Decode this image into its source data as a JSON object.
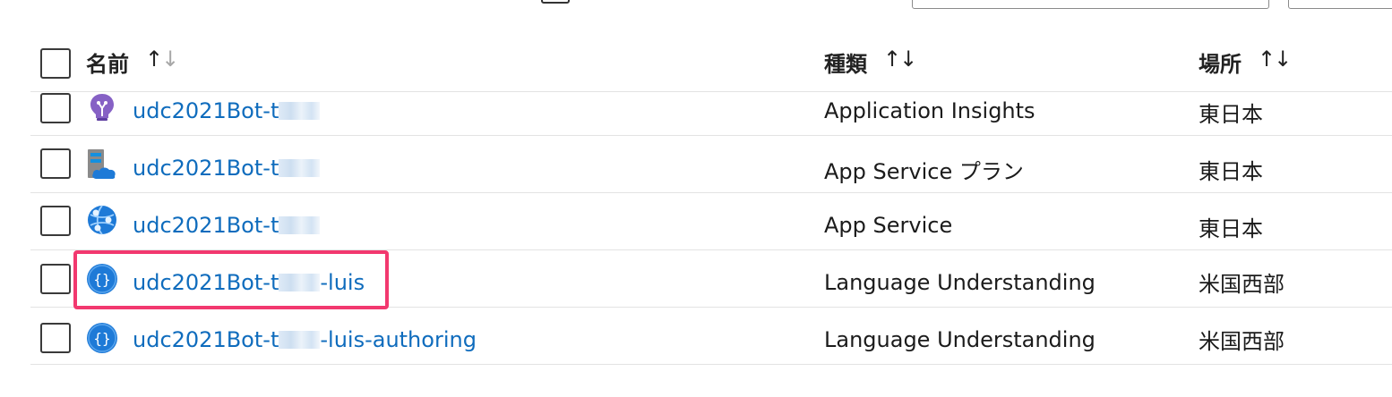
{
  "table": {
    "columns": {
      "name": {
        "label": "名前",
        "sort_up": "↑",
        "sort_down": "↓"
      },
      "type": {
        "label": "種類",
        "sort_up": "↑",
        "sort_down": "↓"
      },
      "location": {
        "label": "場所",
        "sort_up": "↑",
        "sort_down": "↓"
      }
    },
    "rows": [
      {
        "name_prefix": "udc2021Bot-t",
        "name_suffix": "",
        "type": "Application Insights",
        "location": "東日本",
        "icon": "lightbulb-icon"
      },
      {
        "name_prefix": "udc2021Bot-t",
        "name_suffix": "",
        "type": "App Service プラン",
        "location": "東日本",
        "icon": "app-service-plan-icon"
      },
      {
        "name_prefix": "udc2021Bot-t",
        "name_suffix": "",
        "type": "App Service",
        "location": "東日本",
        "icon": "app-service-icon"
      },
      {
        "name_prefix": "udc2021Bot-t",
        "name_suffix": "-luis",
        "type": "Language Understanding",
        "location": "米国西部",
        "icon": "cognitive-services-icon"
      },
      {
        "name_prefix": "udc2021Bot-t",
        "name_suffix": "-luis-authoring",
        "type": "Language Understanding",
        "location": "米国西部",
        "icon": "cognitive-services-icon"
      }
    ]
  },
  "colors": {
    "link": "#0f6cbd",
    "highlight": "#f2386f",
    "divider": "#e3e3e3"
  }
}
